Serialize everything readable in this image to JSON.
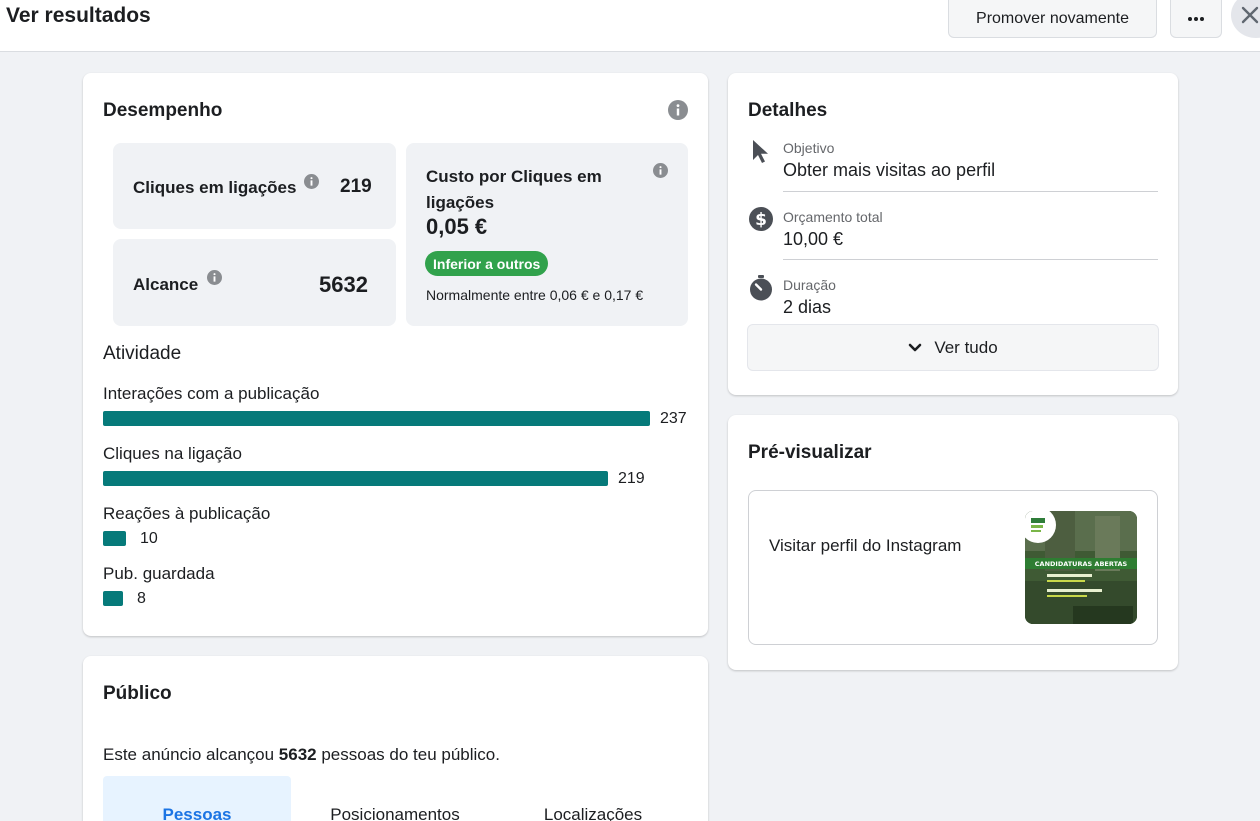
{
  "header": {
    "title": "Ver resultados",
    "promote_label": "Promover novamente",
    "more_label": "•••"
  },
  "performance": {
    "title": "Desempenho",
    "link_clicks": {
      "label": "Cliques em ligações",
      "value": "219"
    },
    "reach": {
      "label": "Alcance",
      "value": "5632"
    },
    "cost_per_click": {
      "label": "Custo por Cliques em ligações",
      "value": "0,05 €",
      "badge": "Inferior a outros",
      "range": "Normalmente entre 0,06 € e 0,17 €"
    }
  },
  "activity": {
    "title": "Atividade",
    "max": 237,
    "items": [
      {
        "label": "Interações com a publicação",
        "value": 237
      },
      {
        "label": "Cliques na ligação",
        "value": 219
      },
      {
        "label": "Reações à publicação",
        "value": 10
      },
      {
        "label": "Pub. guardada",
        "value": 8
      }
    ]
  },
  "details": {
    "title": "Detalhes",
    "objective": {
      "label": "Objetivo",
      "value": "Obter mais visitas ao perfil",
      "icon": "cursor-icon"
    },
    "budget": {
      "label": "Orçamento total",
      "value": "10,00 €",
      "icon": "dollar-icon"
    },
    "duration": {
      "label": "Duração",
      "value": "2 dias",
      "icon": "stopwatch-icon"
    },
    "see_all": "Ver tudo"
  },
  "preview": {
    "title": "Pré-visualizar",
    "cta": "Visitar perfil do Instagram",
    "thumb_banner": "CANDIDATURAS ABERTAS"
  },
  "audience": {
    "title": "Público",
    "text_before": "Este anúncio alcançou ",
    "count": "5632",
    "text_after": " pessoas do teu público.",
    "tabs": [
      "Pessoas",
      "Posicionamentos",
      "Localizações"
    ]
  },
  "colors": {
    "bar": "#067a7a",
    "badge": "#31a24c",
    "active_tab": "#1b74e4"
  }
}
